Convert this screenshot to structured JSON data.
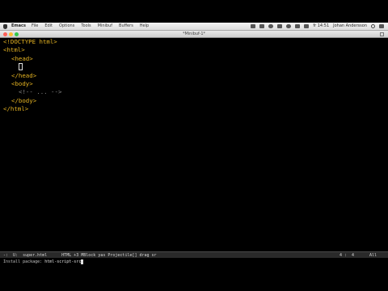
{
  "menubar": {
    "app_name": "Emacs",
    "menus": [
      "File",
      "Edit",
      "Options",
      "Tools",
      "Minibuf",
      "Buffers",
      "Help"
    ],
    "clock": "fr 14:51",
    "user": "Johan Andersson"
  },
  "window": {
    "title": "*Minibuf-1*"
  },
  "editor": {
    "lines": {
      "l1_tag": "<!DOCTYPE html>",
      "l2_tag": "<html>",
      "l3_tag": "<head>",
      "l5_tag": "</head>",
      "l6_tag": "<body>",
      "l7_comment": "<!-- ... -->",
      "l8_tag": "</body>",
      "l9_tag": "</html>"
    }
  },
  "modeline": {
    "status": "-:  U:",
    "filename": "super.html",
    "mode": "HTML +3 MBlock yas Projectile[] drag sr",
    "position": "4 :  4",
    "scope": "All"
  },
  "minibuffer": {
    "prompt": "Install package: ",
    "input": "html-script-src"
  },
  "colors": {
    "tag": "#e6b422",
    "background": "#000000",
    "comment": "#8a8a8a",
    "modeline_bg": "#2a2a2a"
  }
}
